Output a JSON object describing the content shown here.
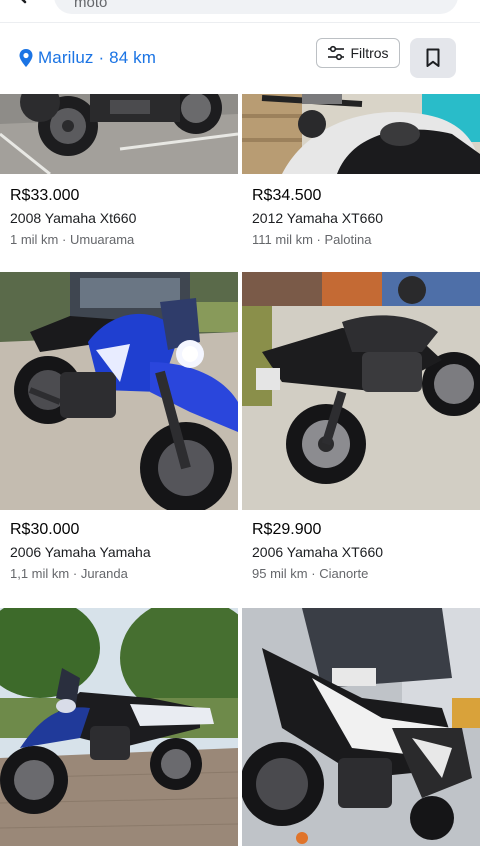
{
  "search": {
    "query": "moto"
  },
  "location": {
    "city": "Mariluz",
    "distance": "84 km"
  },
  "filters": {
    "label": "Filtros"
  },
  "listings": [
    {
      "price": "R$33.000",
      "title": "2008 Yamaha Xt660",
      "mileage": "1 mil km",
      "city": "Umuarama"
    },
    {
      "price": "R$34.500",
      "title": "2012 Yamaha XT660",
      "mileage": "111 mil km",
      "city": "Palotina"
    },
    {
      "price": "R$30.000",
      "title": "2006 Yamaha Yamaha",
      "mileage": "1,1 mil km",
      "city": "Juranda"
    },
    {
      "price": "R$29.900",
      "title": "2006 Yamaha XT660",
      "mileage": "95 mil km",
      "city": "Cianorte"
    },
    {
      "price": "",
      "title": "",
      "mileage": "",
      "city": ""
    },
    {
      "price": "",
      "title": "",
      "mileage": "",
      "city": ""
    }
  ],
  "meta_separator": "·",
  "colors": {
    "accent": "#1b74e4",
    "muted": "#65676b",
    "chip_bg": "#e4e6eb"
  },
  "icons": [
    "back-arrow-icon",
    "location-pin-icon",
    "sliders-icon",
    "bookmark-icon"
  ]
}
